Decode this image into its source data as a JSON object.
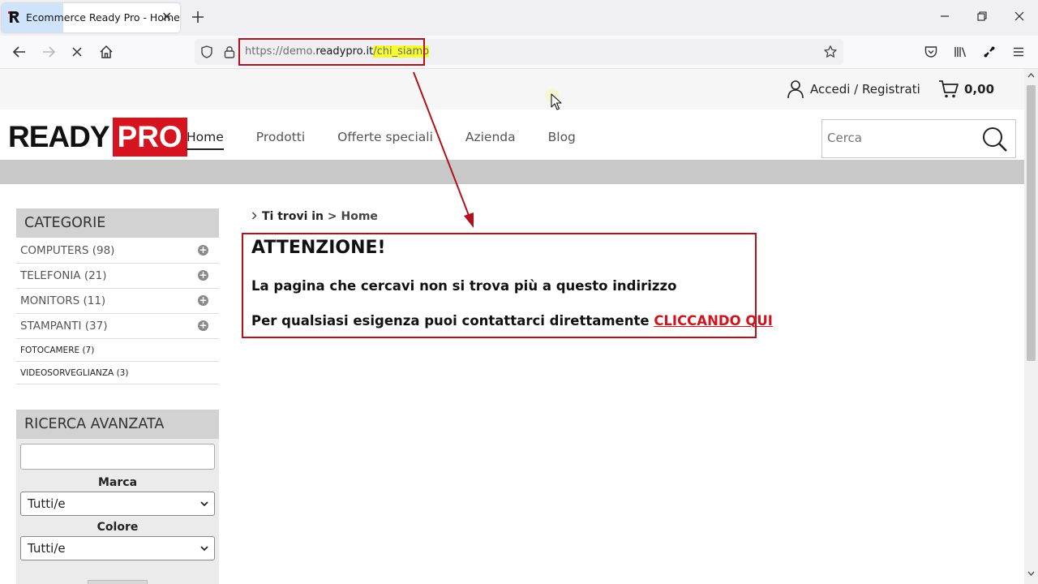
{
  "browser": {
    "tab_title": "Ecommerce Ready Pro - Home",
    "tab_close": "✕",
    "url_prefix": "https://demo.",
    "url_domain": "readypro.it",
    "url_path": "/chi_siamo",
    "annotation_color": "#b0121b",
    "highlight_color": "#f5ff30"
  },
  "topbar": {
    "account_label": "Accedi / Registrati",
    "cart_total": "0,00"
  },
  "header": {
    "logo_ready": "READY",
    "logo_pro": "PRO",
    "brand_color": "#d6141f",
    "nav": [
      "Home",
      "Prodotti",
      "Offerte speciali",
      "Azienda",
      "Blog"
    ],
    "nav_active": "Home",
    "search_placeholder": "Cerca"
  },
  "sidebar": {
    "categories_title": "CATEGORIE",
    "categories": [
      {
        "label": "COMPUTERS (98)",
        "expandable": true
      },
      {
        "label": "TELEFONIA (21)",
        "expandable": true
      },
      {
        "label": "MONITORS (11)",
        "expandable": true
      },
      {
        "label": "STAMPANTI (37)",
        "expandable": true
      },
      {
        "label": "FOTOCAMERE (7)",
        "expandable": false
      },
      {
        "label": "VIDEOSORVEGLIANZA (3)",
        "expandable": false
      }
    ],
    "advanced_title": "RICERCA AVANZATA",
    "brand_label": "Marca",
    "brand_value": "Tutti/e",
    "color_label": "Colore",
    "color_value": "Tutti/e"
  },
  "main": {
    "breadcrumb_prefix": "Ti trovi in",
    "breadcrumb_sep": ">",
    "breadcrumb_current": "Home",
    "alert_title": "ATTENZIONE!",
    "alert_message_1": "La pagina che cercavi non si trova più a questo indirizzo",
    "alert_message_2": "Per qualsiasi esigenza puoi contattarci direttamente",
    "alert_link": "CLICCANDO QUI",
    "link_color": "#d0141e"
  }
}
